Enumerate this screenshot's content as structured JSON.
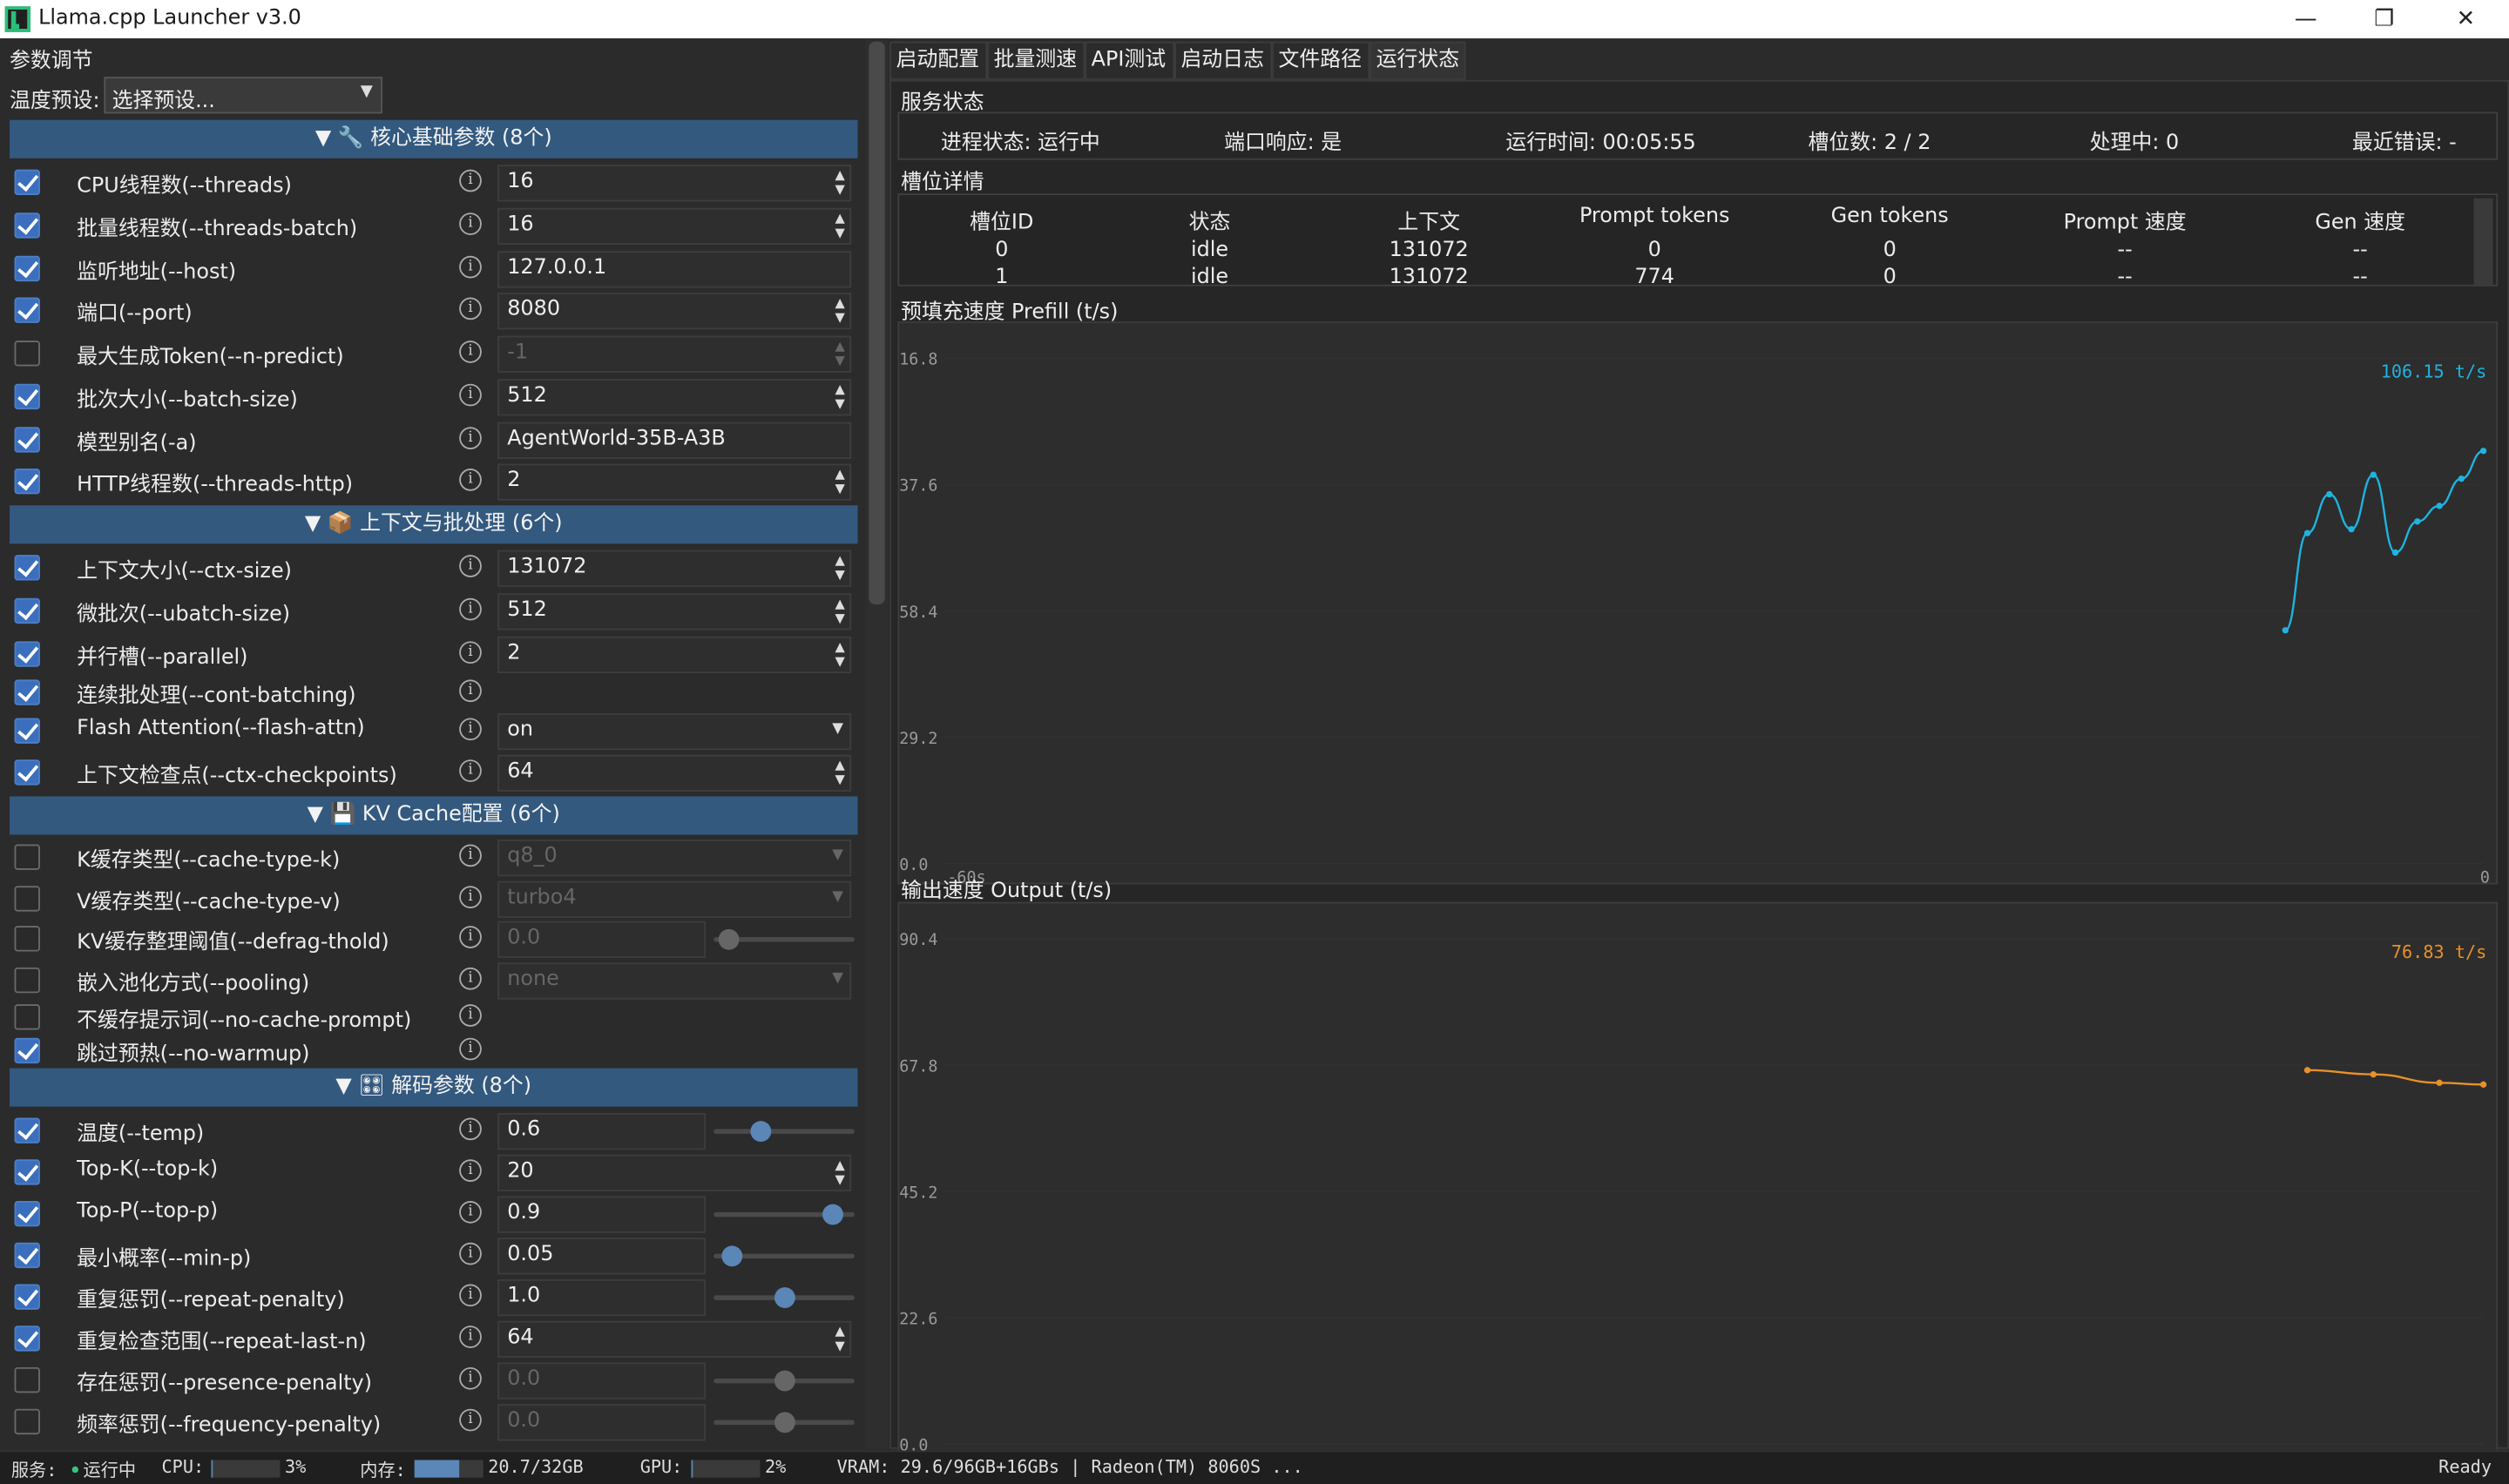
{
  "window": {
    "title": "Llama.cpp Launcher v3.0"
  },
  "left": {
    "section_title": "参数调节",
    "preset_label": "温度预设:",
    "preset_value": "选择预设...",
    "groups": [
      {
        "label": "▼  🔧 核心基础参数 (8个)"
      },
      {
        "label": "▼  📦 上下文与批处理 (6个)"
      },
      {
        "label": "▼  💾 KV Cache配置 (6个)"
      },
      {
        "label": "▼  🎛 解码参数 (8个)"
      }
    ],
    "rows": [
      {
        "checked": true,
        "label": "CPU线程数(--threads)",
        "value": "16",
        "control": "spin",
        "disabled": false
      },
      {
        "checked": true,
        "label": "批量线程数(--threads-batch)",
        "value": "16",
        "control": "spin",
        "disabled": false
      },
      {
        "checked": true,
        "label": "监听地址(--host)",
        "value": "127.0.0.1",
        "control": "text",
        "disabled": false
      },
      {
        "checked": true,
        "label": "端口(--port)",
        "value": "8080",
        "control": "spin",
        "disabled": false
      },
      {
        "checked": false,
        "label": "最大生成Token(--n-predict)",
        "value": "-1",
        "control": "spin",
        "disabled": true
      },
      {
        "checked": true,
        "label": "批次大小(--batch-size)",
        "value": "512",
        "control": "spin",
        "disabled": false
      },
      {
        "checked": true,
        "label": "模型别名(-a)",
        "value": "AgentWorld-35B-A3B",
        "control": "text",
        "disabled": false
      },
      {
        "checked": true,
        "label": "HTTP线程数(--threads-http)",
        "value": "2",
        "control": "spin",
        "disabled": false
      },
      {
        "checked": true,
        "label": "上下文大小(--ctx-size)",
        "value": "131072",
        "control": "spin",
        "disabled": false
      },
      {
        "checked": true,
        "label": "微批次(--ubatch-size)",
        "value": "512",
        "control": "spin",
        "disabled": false
      },
      {
        "checked": true,
        "label": "并行槽(--parallel)",
        "value": "2",
        "control": "spin",
        "disabled": false
      },
      {
        "checked": true,
        "label": "连续批处理(--cont-batching)",
        "value": "",
        "control": "none",
        "disabled": false
      },
      {
        "checked": true,
        "label": "Flash Attention(--flash-attn)",
        "value": "on",
        "control": "select",
        "disabled": false
      },
      {
        "checked": true,
        "label": "上下文检查点(--ctx-checkpoints)",
        "value": "64",
        "control": "spin",
        "disabled": false
      },
      {
        "checked": false,
        "label": "K缓存类型(--cache-type-k)",
        "value": "q8_0",
        "control": "select",
        "disabled": true
      },
      {
        "checked": false,
        "label": "V缓存类型(--cache-type-v)",
        "value": "turbo4",
        "control": "select",
        "disabled": true
      },
      {
        "checked": false,
        "label": "KV缓存整理阈值(--defrag-thold)",
        "value": "0.0",
        "control": "slider",
        "disabled": true,
        "level": 0.1
      },
      {
        "checked": false,
        "label": "嵌入池化方式(--pooling)",
        "value": "none",
        "control": "select",
        "disabled": true
      },
      {
        "checked": false,
        "label": "不缓存提示词(--no-cache-prompt)",
        "value": "",
        "control": "none",
        "disabled": false
      },
      {
        "checked": true,
        "label": "跳过预热(--no-warmup)",
        "value": "",
        "control": "none",
        "disabled": false
      },
      {
        "checked": true,
        "label": "温度(--temp)",
        "value": "0.6",
        "control": "slider",
        "disabled": false,
        "level": 0.33
      },
      {
        "checked": true,
        "label": "Top-K(--top-k)",
        "value": "20",
        "control": "spin",
        "disabled": false
      },
      {
        "checked": true,
        "label": "Top-P(--top-p)",
        "value": "0.9",
        "control": "slider",
        "disabled": false,
        "level": 0.84
      },
      {
        "checked": true,
        "label": "最小概率(--min-p)",
        "value": "0.05",
        "control": "slider",
        "disabled": false,
        "level": 0.12
      },
      {
        "checked": true,
        "label": "重复惩罚(--repeat-penalty)",
        "value": "1.0",
        "control": "slider",
        "disabled": false,
        "level": 0.5
      },
      {
        "checked": true,
        "label": "重复检查范围(--repeat-last-n)",
        "value": "64",
        "control": "spin",
        "disabled": false
      },
      {
        "checked": false,
        "label": "存在惩罚(--presence-penalty)",
        "value": "0.0",
        "control": "slider",
        "disabled": true,
        "level": 0.5
      },
      {
        "checked": false,
        "label": "频率惩罚(--frequency-penalty)",
        "value": "0.0",
        "control": "slider",
        "disabled": true,
        "level": 0.5
      }
    ]
  },
  "tabs": [
    {
      "label": "启动配置",
      "active": false
    },
    {
      "label": "批量测速",
      "active": false
    },
    {
      "label": "API测试",
      "active": false
    },
    {
      "label": "启动日志",
      "active": false
    },
    {
      "label": "文件路径",
      "active": false
    },
    {
      "label": "运行状态",
      "active": true
    }
  ],
  "service": {
    "title": "服务状态",
    "items": [
      "进程状态: 运行中",
      "端口响应: 是",
      "运行时间: 00:05:55",
      "槽位数: 2 / 2",
      "处理中: 0",
      "最近错误: -"
    ]
  },
  "slots": {
    "title": "槽位详情",
    "columns": [
      "槽位ID",
      "状态",
      "上下文",
      "Prompt tokens",
      "Gen tokens",
      "Prompt 速度",
      "Gen 速度"
    ],
    "rows": [
      [
        "0",
        "idle",
        "131072",
        "0",
        "0",
        "--",
        "--"
      ],
      [
        "1",
        "idle",
        "131072",
        "774",
        "0",
        "--",
        "--"
      ]
    ]
  },
  "chart_data": [
    {
      "type": "line",
      "title": "预填充速度 Prefill (t/s)",
      "color": "#1fb3e0",
      "current_label": "106.15 t/s",
      "yticks": [
        "16.8",
        "37.6",
        "58.4",
        "29.2",
        "0.0"
      ],
      "xticks": [
        "-60s",
        "0"
      ],
      "x": [
        -9,
        -8,
        -7,
        -6,
        -5,
        -4,
        -3,
        -2,
        -1,
        0
      ],
      "y": [
        60,
        85,
        95,
        86,
        100,
        80,
        88,
        92,
        99,
        106.15
      ]
    },
    {
      "type": "line",
      "title": "输出速度 Output (t/s)",
      "color": "#e8902a",
      "current_label": "76.83 t/s",
      "yticks": [
        "90.4",
        "67.8",
        "45.2",
        "22.6",
        "0.0"
      ],
      "xticks": [
        "-60s",
        "0"
      ],
      "x": [
        -8,
        -5,
        -2,
        0
      ],
      "y": [
        79.9,
        79.0,
        77.2,
        76.83
      ]
    }
  ],
  "statusbar": {
    "service": "服务:",
    "service_state": "运行中",
    "cpu_label": "CPU:",
    "cpu_pct": "3%",
    "cpu_level": 0.03,
    "mem_label": "内存:",
    "mem_value": "20.7/32GB",
    "mem_level": 0.65,
    "gpu_label": "GPU:",
    "gpu_pct": "2%",
    "gpu_level": 0.02,
    "vram": "VRAM: 29.6/96GB+16GBs | Radeon(TM) 8060S ...",
    "ready": "Ready"
  },
  "colors": {
    "accent": "#33597f",
    "checkbox": "#3b6fbd",
    "prefill": "#1fb3e0",
    "output": "#e8902a"
  }
}
